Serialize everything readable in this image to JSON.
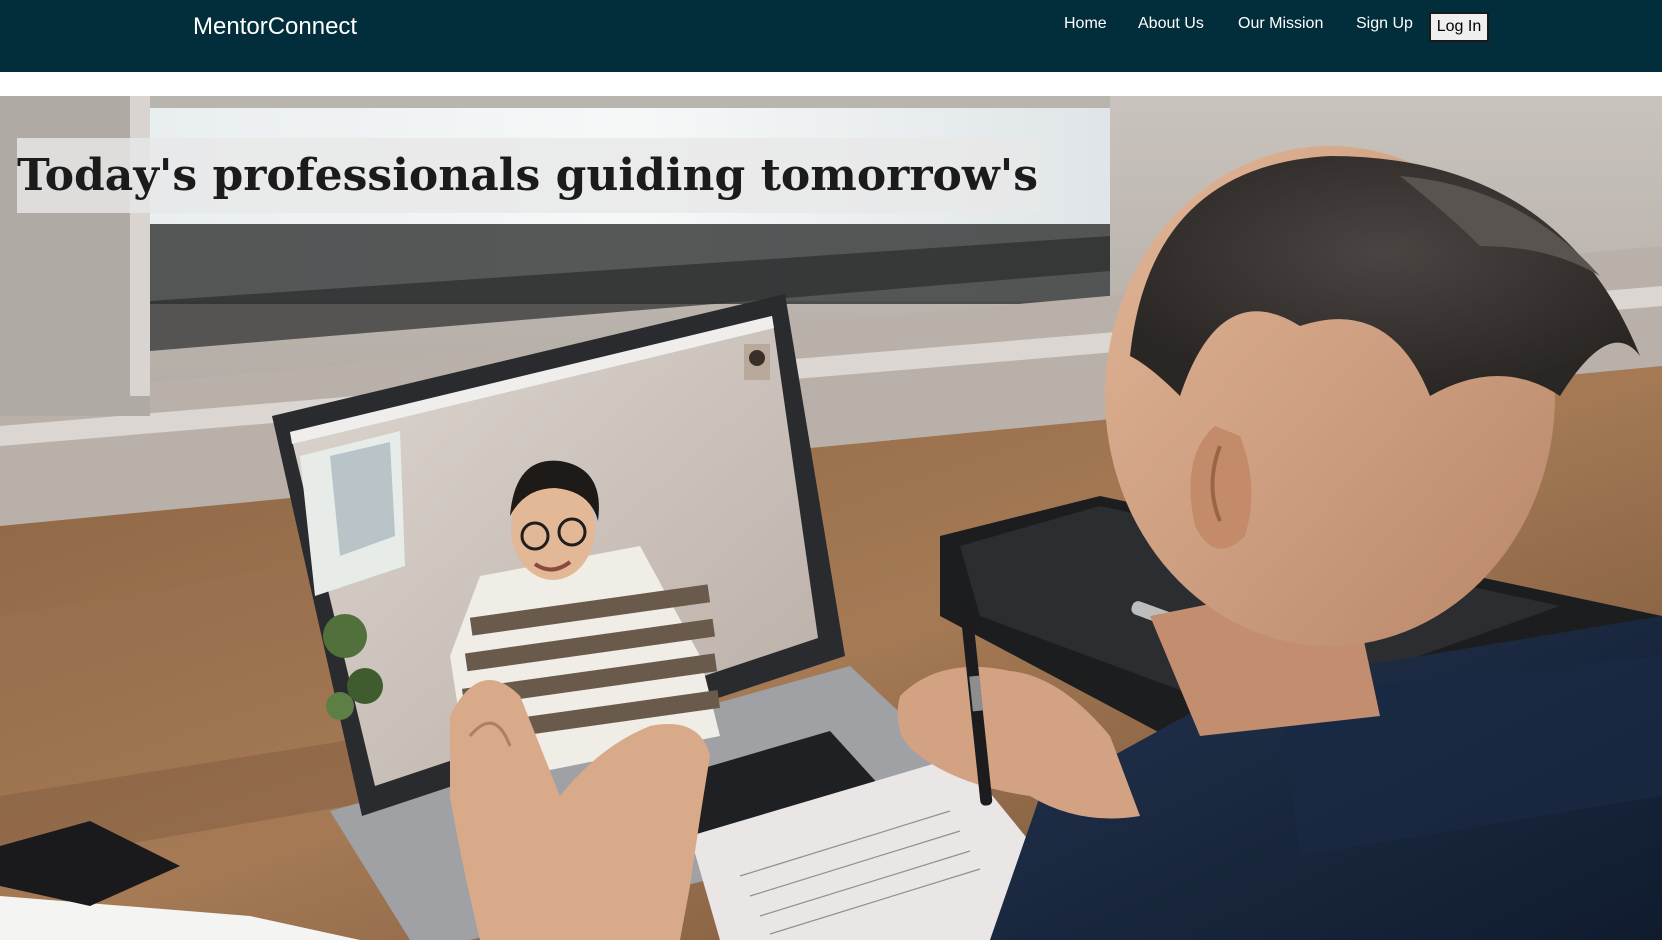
{
  "nav": {
    "brand": "MentorConnect",
    "links": [
      "Home",
      "About Us",
      "Our Mission",
      "Sign Up"
    ],
    "login_label": "Log In"
  },
  "hero": {
    "title": "Today's professionals guiding tomorrow's"
  },
  "colors": {
    "navbar_bg": "#022d3a",
    "nav_text": "#ffffff",
    "title_text": "#1b1b1b"
  }
}
